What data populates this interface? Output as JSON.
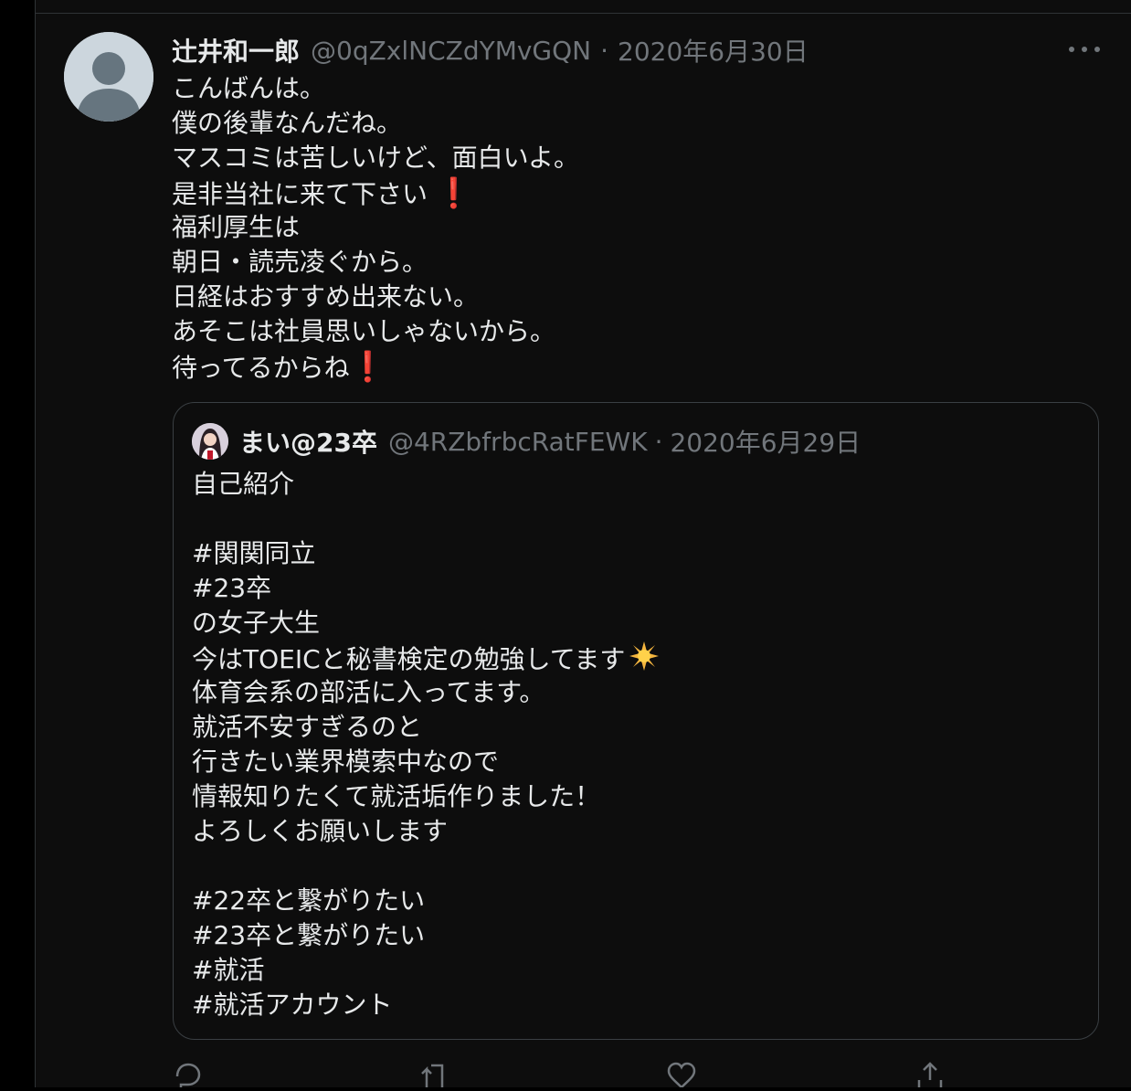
{
  "tweet": {
    "author_name": "辻井和一郎",
    "handle": "@0qZxlNCZdYMvGQN",
    "separator": "·",
    "date": "2020年6月30日",
    "lines": [
      "こんばんは。",
      "僕の後輩なんだね。",
      "マスコミは苦しいけど、面白いよ。",
      "是非当社に来て下さい",
      "福利厚生は",
      "朝日・読売凌ぐから。",
      "日経はおすすめ出来ない。",
      "あそこは社員思いしゃないから。",
      "待ってるからね"
    ],
    "exclamation": "❗"
  },
  "quoted": {
    "author_name": "まい@23卒",
    "handle": "@4RZbfrbcRatFEWK",
    "separator": "·",
    "date": "2020年6月29日",
    "lines": [
      "自己紹介",
      "",
      "#関関同立",
      "#23卒",
      "の女子大生",
      "今はTOEICと秘書検定の勉強してます",
      "体育会系の部活に入ってます。",
      "就活不安すぎるのと",
      "行きたい業界模索中なので",
      "情報知りたくて就活垢作りました！",
      "よろしくお願いします",
      "",
      "#22卒と繋がりたい",
      "#23卒と繋がりたい",
      "#就活",
      "#就活アカウント"
    ]
  },
  "icons": {
    "more": "more-horizontal-icon",
    "reply": "reply-icon",
    "retweet": "retweet-icon",
    "like": "heart-icon",
    "share": "share-icon",
    "sparkle": "glowing-star-emoji"
  },
  "colors": {
    "background": "#0d0d0d",
    "text": "#e7e9ea",
    "secondary": "#71767b",
    "border": "#3a3f43",
    "exclamation": "#e0245e"
  }
}
